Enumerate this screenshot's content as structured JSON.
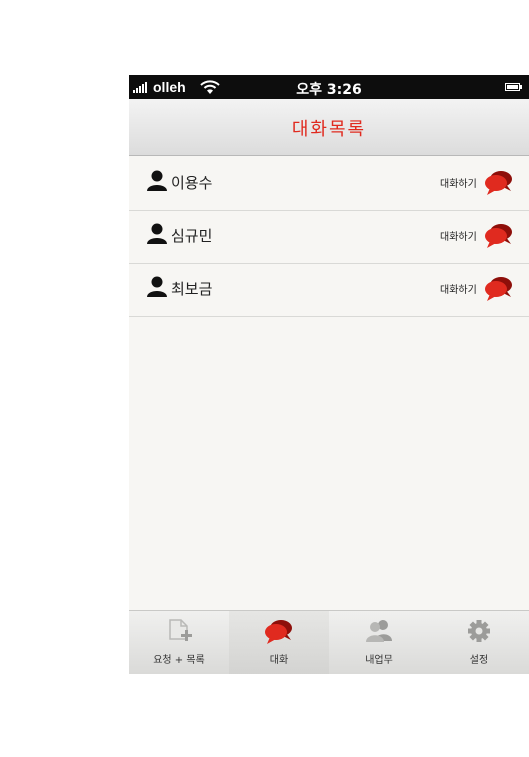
{
  "status_bar": {
    "carrier": "olleh",
    "time": "오후 3:26",
    "signal_icon": "signal-bars-icon",
    "wifi_icon": "wifi-icon",
    "battery_icon": "battery-icon"
  },
  "nav": {
    "title": "대화목록"
  },
  "colors": {
    "accent": "#e02a1f",
    "status_bar_bg": "#0d0d0d",
    "background": "#f7f6f3"
  },
  "contacts": [
    {
      "name": "이용수",
      "action_label": "대화하기",
      "icon": "person-icon",
      "action_icon": "chat-bubbles-icon"
    },
    {
      "name": "심규민",
      "action_label": "대화하기",
      "icon": "person-icon",
      "action_icon": "chat-bubbles-icon"
    },
    {
      "name": "최보금",
      "action_label": "대화하기",
      "icon": "person-icon",
      "action_icon": "chat-bubbles-icon"
    }
  ],
  "tabs": [
    {
      "label": "요청 + 목록",
      "icon": "new-document-icon",
      "selected": false
    },
    {
      "label": "대화",
      "icon": "chat-bubbles-icon",
      "selected": true
    },
    {
      "label": "내업무",
      "icon": "people-icon",
      "selected": false
    },
    {
      "label": "설정",
      "icon": "gear-icon",
      "selected": false
    }
  ]
}
